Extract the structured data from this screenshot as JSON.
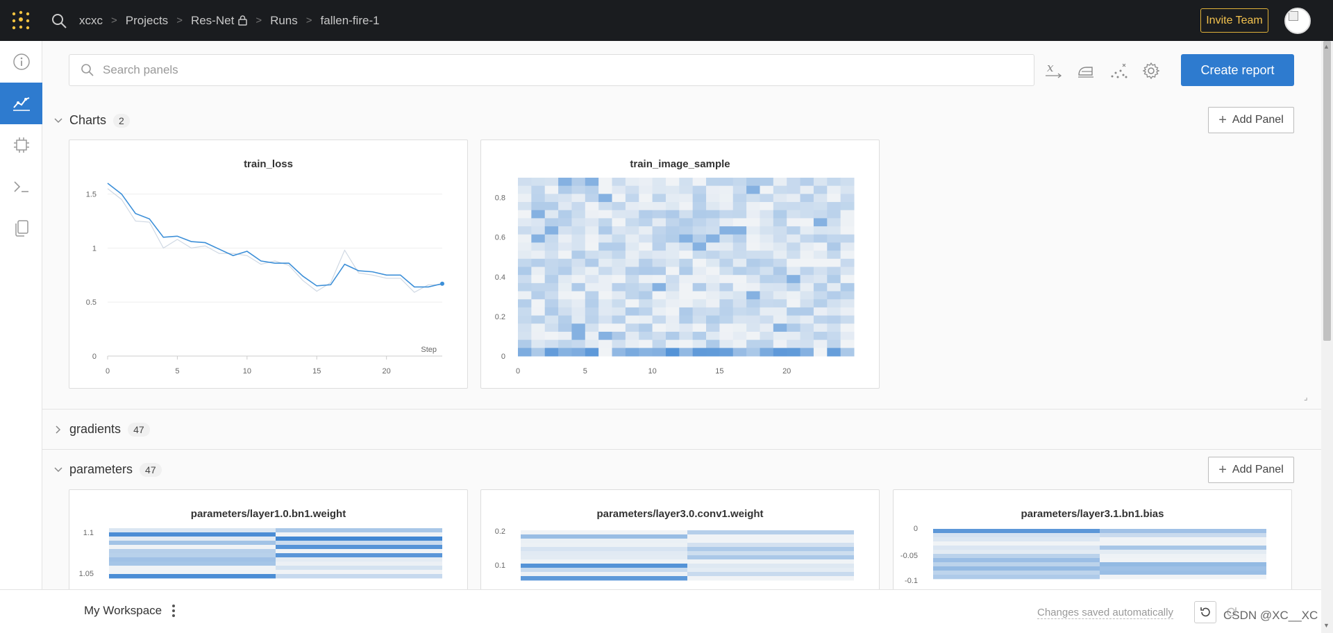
{
  "topbar": {
    "breadcrumbs": [
      "xcxc",
      "Projects",
      "Res-Net",
      "Runs",
      "fallen-fire-1"
    ],
    "invite_label": "Invite Team"
  },
  "toolbar": {
    "search_placeholder": "Search panels",
    "create_report_label": "Create report"
  },
  "sections": {
    "charts": {
      "title": "Charts",
      "count": "2"
    },
    "gradients": {
      "title": "gradients",
      "count": "47"
    },
    "parameters": {
      "title": "parameters",
      "count": "47"
    }
  },
  "add_panel_label": "Add Panel",
  "panels": {
    "train_loss": {
      "title": "train_loss",
      "step_label": "Step"
    },
    "train_image_sample": {
      "title": "train_image_sample"
    },
    "p1": {
      "title": "parameters/layer1.0.bn1.weight"
    },
    "p2": {
      "title": "parameters/layer3.0.conv1.weight"
    },
    "p3": {
      "title": "parameters/layer3.1.bn1.bias"
    }
  },
  "bottombar": {
    "workspace_label": "My Workspace",
    "saved_label": "Changes saved automatically",
    "watermark": "CSDN @XC__XC"
  },
  "colors": {
    "accent": "#2e7bcf",
    "topbar": "#1a1c1f",
    "invite": "#f3c24e"
  },
  "chart_data": [
    {
      "type": "line",
      "title": "train_loss",
      "xlabel": "Step",
      "ylabel": "",
      "xlim": [
        0,
        24
      ],
      "ylim": [
        0,
        1.6
      ],
      "x_ticks": [
        0,
        5,
        10,
        15,
        20
      ],
      "y_ticks": [
        0,
        0.5,
        1,
        1.5
      ],
      "y_tick_labels": [
        "0",
        "0.5",
        "1",
        "1.5"
      ],
      "grid": true,
      "series": [
        {
          "x": [
            0,
            1,
            2,
            3,
            4,
            5,
            6,
            7,
            8,
            9,
            10,
            11,
            12,
            13,
            14,
            15,
            16,
            17,
            18,
            19,
            20,
            21,
            22,
            23,
            24
          ],
          "values": [
            1.6,
            1.5,
            1.32,
            1.27,
            1.1,
            1.11,
            1.06,
            1.05,
            0.99,
            0.93,
            0.97,
            0.88,
            0.86,
            0.86,
            0.74,
            0.65,
            0.66,
            0.85,
            0.79,
            0.78,
            0.75,
            0.75,
            0.64,
            0.64,
            0.67
          ],
          "color": "#3c8fd8"
        },
        {
          "x": [
            0,
            1,
            2,
            3,
            4,
            5,
            6,
            7,
            8,
            9,
            10,
            11,
            12,
            13,
            14,
            15,
            16,
            17,
            18,
            19,
            20,
            21,
            22,
            23,
            24
          ],
          "values": [
            1.55,
            1.45,
            1.25,
            1.24,
            1.0,
            1.08,
            1.0,
            1.02,
            0.95,
            0.95,
            0.93,
            0.85,
            0.88,
            0.84,
            0.7,
            0.6,
            0.68,
            0.98,
            0.77,
            0.75,
            0.72,
            0.72,
            0.59,
            0.66,
            0.66
          ],
          "color": "#cfd8e3"
        }
      ]
    },
    {
      "type": "heatmap",
      "title": "train_image_sample",
      "xlim": [
        0,
        25
      ],
      "ylim": [
        0,
        0.9
      ],
      "x_ticks": [
        0,
        5,
        10,
        15,
        20
      ],
      "y_ticks": [
        0,
        0.2,
        0.4,
        0.6,
        0.8
      ],
      "y_tick_labels": [
        "0",
        "0.2",
        "0.4",
        "0.6",
        "0.8"
      ],
      "columns": 25
    },
    {
      "type": "heatmap",
      "title": "parameters/layer1.0.bn1.weight",
      "y_ticks": [
        1.05,
        1.1
      ],
      "y_tick_labels": [
        "1.05",
        "1.1"
      ],
      "columns": 2
    },
    {
      "type": "heatmap",
      "title": "parameters/layer3.0.conv1.weight",
      "y_ticks": [
        0.1,
        0.2
      ],
      "y_tick_labels": [
        "0.1",
        "0.2"
      ],
      "columns": 2
    },
    {
      "type": "heatmap",
      "title": "parameters/layer3.1.bn1.bias",
      "y_ticks": [
        -0.1,
        -0.05,
        0
      ],
      "y_tick_labels": [
        "-0.1",
        "-0.05",
        "0"
      ],
      "columns": 2
    }
  ]
}
